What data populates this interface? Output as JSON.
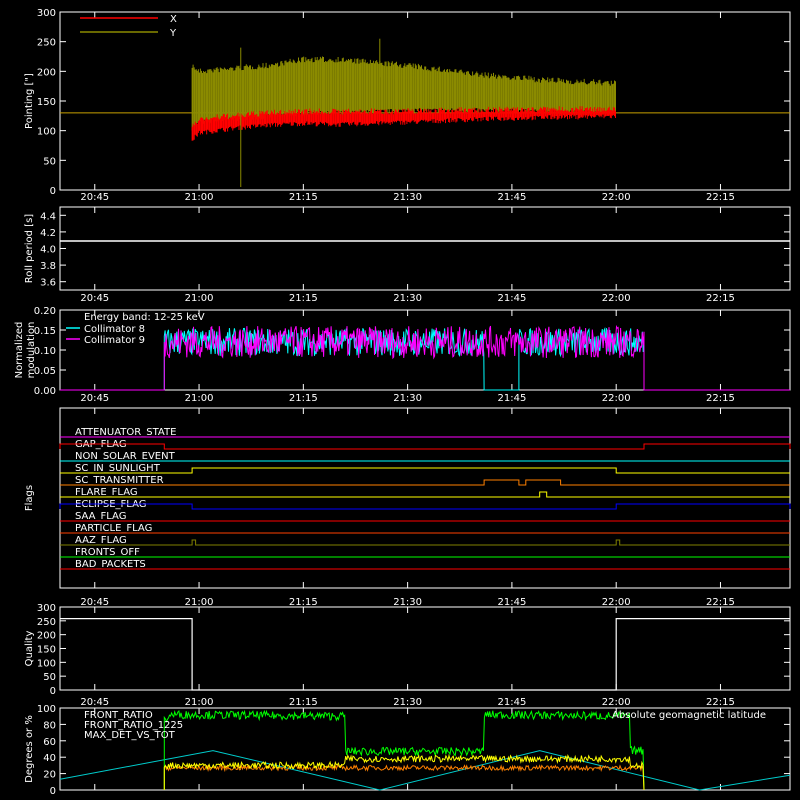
{
  "chart_data": [
    {
      "type": "line",
      "panel": "pointing",
      "ylabel": "Pointing [\"]",
      "ylim": [
        0,
        300
      ],
      "yticks": [
        "0",
        "50",
        "100",
        "150",
        "200",
        "250",
        "300"
      ],
      "xlim": [
        "20:40",
        "22:25"
      ],
      "xticks": [
        "20:45",
        "21:00",
        "21:15",
        "21:30",
        "21:45",
        "22:00",
        "22:15"
      ],
      "legend_position": "top-left",
      "reference_line": 130,
      "series": [
        {
          "name": "X",
          "color": "#ff0000",
          "time": [
            "20:59",
            "21:00",
            "21:05",
            "21:10",
            "21:15",
            "21:20",
            "21:30",
            "21:40",
            "21:50",
            "22:00"
          ],
          "low": [
            80,
            92,
            100,
            105,
            108,
            106,
            110,
            115,
            118,
            120
          ],
          "high": [
            110,
            125,
            130,
            135,
            138,
            137,
            138,
            140,
            141,
            142
          ]
        },
        {
          "name": "Y",
          "color": "#8b8b00",
          "time": [
            "20:59",
            "21:00",
            "21:05",
            "21:10",
            "21:15",
            "21:20",
            "21:30",
            "21:40",
            "21:50",
            "22:00"
          ],
          "low": [
            100,
            110,
            115,
            120,
            125,
            125,
            130,
            130,
            128,
            125
          ],
          "high": [
            215,
            205,
            210,
            215,
            225,
            225,
            215,
            200,
            190,
            185
          ]
        }
      ]
    },
    {
      "type": "line",
      "panel": "roll-period",
      "ylabel": "Roll period [s]",
      "ylim": [
        3.5,
        4.5
      ],
      "yticks": [
        "3.6",
        "3.8",
        "4.0",
        "4.2",
        "4.4"
      ],
      "xticks": [
        "20:45",
        "21:00",
        "21:15",
        "21:30",
        "21:45",
        "22:00",
        "22:15"
      ],
      "series": [
        {
          "color": "#ffffff",
          "time": [
            "20:40",
            "22:25"
          ],
          "values": [
            4.09,
            4.09
          ]
        }
      ]
    },
    {
      "type": "line",
      "panel": "modulation",
      "ylabel": "Normalized modulation",
      "ylim": [
        0,
        0.2
      ],
      "yticks": [
        "0.00",
        "0.05",
        "0.10",
        "0.15",
        "0.20"
      ],
      "xticks": [
        "20:45",
        "21:00",
        "21:15",
        "21:30",
        "21:45",
        "22:00",
        "22:15"
      ],
      "annotation": "Energy band: 12-25 keV",
      "series": [
        {
          "name": "Collimator 8",
          "color": "#00ffff",
          "segments": [
            [
              "20:55",
              "21:41"
            ],
            [
              "21:46",
              "22:04"
            ]
          ],
          "level": 0.12,
          "noise": 0.035
        },
        {
          "name": "Collimator 9",
          "color": "#ff00ff",
          "segments": [
            [
              "20:55",
              "22:04"
            ]
          ],
          "level": 0.12,
          "noise": 0.04
        }
      ]
    },
    {
      "type": "line",
      "panel": "flags",
      "ylabel": "Flags",
      "xticks": [
        "20:45",
        "21:00",
        "21:15",
        "21:30",
        "21:45",
        "22:00",
        "22:15"
      ],
      "series": [
        {
          "name": "ATTENUATOR_STATE",
          "color": "#ff00ff",
          "high": []
        },
        {
          "name": "GAP_FLAG",
          "color": "#ff0000",
          "high": [
            [
              "20:40",
              "20:55"
            ],
            [
              "22:04",
              "22:25"
            ]
          ]
        },
        {
          "name": "NON_SOLAR_EVENT",
          "color": "#00ffff",
          "high": []
        },
        {
          "name": "SC_IN_SUNLIGHT",
          "color": "#ffff00",
          "high": [
            [
              "20:59",
              "22:00"
            ]
          ]
        },
        {
          "name": "SC_TRANSMITTER",
          "color": "#ff8000",
          "high": [
            [
              "21:41",
              "21:46"
            ],
            [
              "21:47",
              "21:52"
            ]
          ]
        },
        {
          "name": "FLARE_FLAG",
          "color": "#ffff00",
          "high": [
            [
              "21:49",
              "21:50"
            ]
          ]
        },
        {
          "name": "ECLIPSE_FLAG",
          "color": "#0000ff",
          "high": [
            [
              "20:40",
              "20:59"
            ],
            [
              "22:00",
              "22:25"
            ]
          ]
        },
        {
          "name": "SAA_FLAG",
          "color": "#ff0000",
          "high": []
        },
        {
          "name": "PARTICLE_FLAG",
          "color": "#ff4000",
          "high": []
        },
        {
          "name": "AAZ_FLAG",
          "color": "#808000",
          "high": [
            [
              "20:59",
              "20:59.5"
            ],
            [
              "22:00",
              "22:00.5"
            ]
          ]
        },
        {
          "name": "FRONTS_OFF",
          "color": "#00ff00",
          "high": []
        },
        {
          "name": "BAD_PACKETS",
          "color": "#ff0000",
          "high": []
        }
      ]
    },
    {
      "type": "line",
      "panel": "quality",
      "ylabel": "Quality",
      "ylim": [
        0,
        300
      ],
      "yticks": [
        "0",
        "50",
        "100",
        "150",
        "200",
        "250",
        "300"
      ],
      "xticks": [
        "20:45",
        "21:00",
        "21:15",
        "21:30",
        "21:45",
        "22:00",
        "22:15"
      ],
      "series": [
        {
          "color": "#ffffff",
          "time": [
            "20:40",
            "20:59",
            "20:59",
            "22:00",
            "22:00",
            "22:25"
          ],
          "values": [
            258,
            258,
            0,
            0,
            258,
            258
          ]
        }
      ]
    },
    {
      "type": "line",
      "panel": "ratios",
      "ylabel": "Degrees or %",
      "ylim": [
        0,
        100
      ],
      "yticks": [
        "0",
        "20",
        "40",
        "60",
        "80",
        "100"
      ],
      "xticks": [
        "20:45",
        "21:00",
        "21:15",
        "21:30",
        "21:45",
        "22:00",
        "22:15"
      ],
      "right_label": "Absolute geomagnetic latitude",
      "series": [
        {
          "name": "FRONT_RATIO",
          "color": "#ffff00",
          "time": [
            "20:55",
            "21:21",
            "21:21",
            "21:41",
            "21:41",
            "22:02",
            "22:02",
            "22:04"
          ],
          "values": [
            30,
            30,
            38,
            38,
            38,
            38,
            30,
            30
          ]
        },
        {
          "name": "FRONT_RATIO_1225",
          "color": "#00ff00",
          "time": [
            "20:55",
            "20:56",
            "21:21",
            "21:21",
            "21:41",
            "21:41",
            "22:02",
            "22:02",
            "22:04"
          ],
          "values": [
            85,
            92,
            90,
            47,
            47,
            92,
            90,
            48,
            48
          ]
        },
        {
          "name": "MAX_DET_VS_TOT",
          "color": "#ff8000",
          "time": [
            "20:55",
            "22:04"
          ],
          "values": [
            27,
            27
          ]
        },
        {
          "name": "Absolute geomagnetic latitude",
          "color": "#00cccc",
          "time": [
            "20:40",
            "21:02",
            "21:26",
            "21:49",
            "22:12",
            "22:25"
          ],
          "values": [
            13,
            48,
            0,
            48,
            0,
            18
          ]
        }
      ]
    }
  ]
}
